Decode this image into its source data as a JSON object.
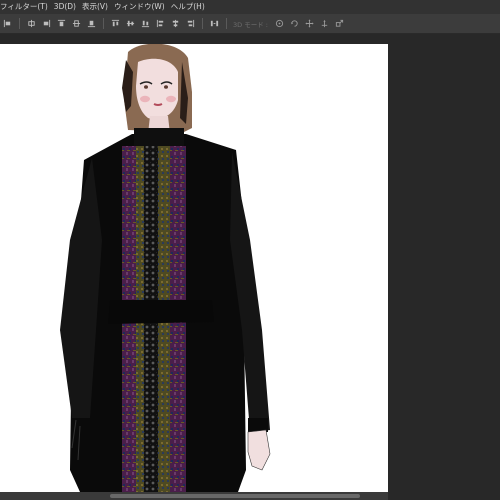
{
  "menubar": {
    "items": [
      {
        "label": "フィルター(T)"
      },
      {
        "label": "3D(D)"
      },
      {
        "label": "表示(V)"
      },
      {
        "label": "ウィンドウ(W)"
      },
      {
        "label": "ヘルプ(H)"
      }
    ]
  },
  "optionsbar": {
    "mode_3d_label": "3D モード :",
    "icons": [
      "align-left-icon",
      "align-center-icon",
      "align-right-icon",
      "distribute-icon",
      "orbit-icon",
      "roll-icon",
      "pan-icon",
      "slide-icon",
      "scale-icon"
    ]
  },
  "colors": {
    "menubar_bg": "#323232",
    "optionsbar_bg": "#3c3c3c",
    "workspace_bg": "#282828",
    "dress_black": "#0a0a0a",
    "panel_purple": "#4a1e4a"
  }
}
